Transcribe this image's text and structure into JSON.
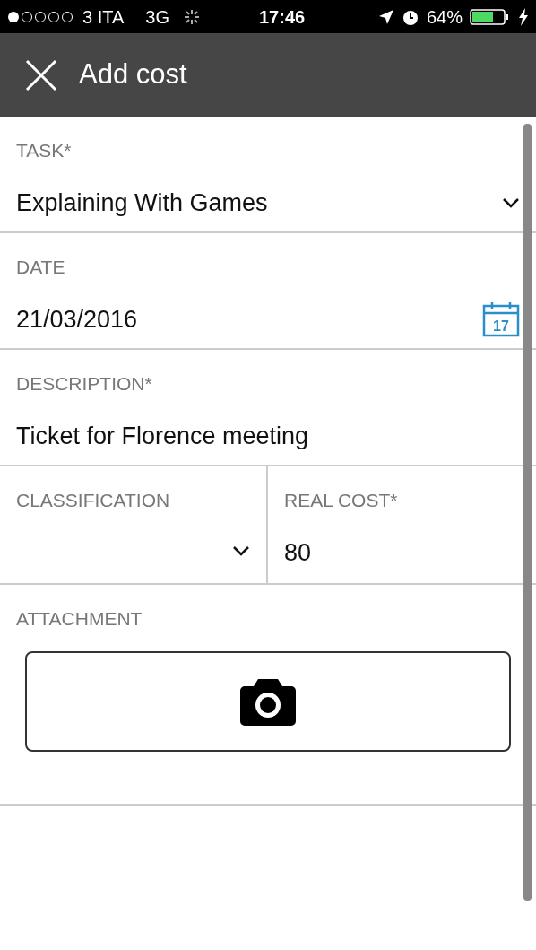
{
  "status_bar": {
    "carrier": "3 ITA",
    "network": "3G",
    "time": "17:46",
    "battery": "64%"
  },
  "header": {
    "title": "Add cost"
  },
  "fields": [
    {
      "label": "TASK*",
      "value": "Explaining With Games",
      "kind": "select"
    },
    {
      "label": "DATE",
      "value": "21/03/2016",
      "kind": "date",
      "icon_text": "17"
    },
    {
      "label": "DESCRIPTION*",
      "value": "Ticket for Florence meeting",
      "kind": "text"
    }
  ],
  "split_fields": [
    {
      "label": "CLASSIFICATION",
      "kind": "select"
    },
    {
      "label": "REAL COST*",
      "value": "80",
      "kind": "text"
    }
  ],
  "attachment": {
    "label": "ATTACHMENT"
  }
}
